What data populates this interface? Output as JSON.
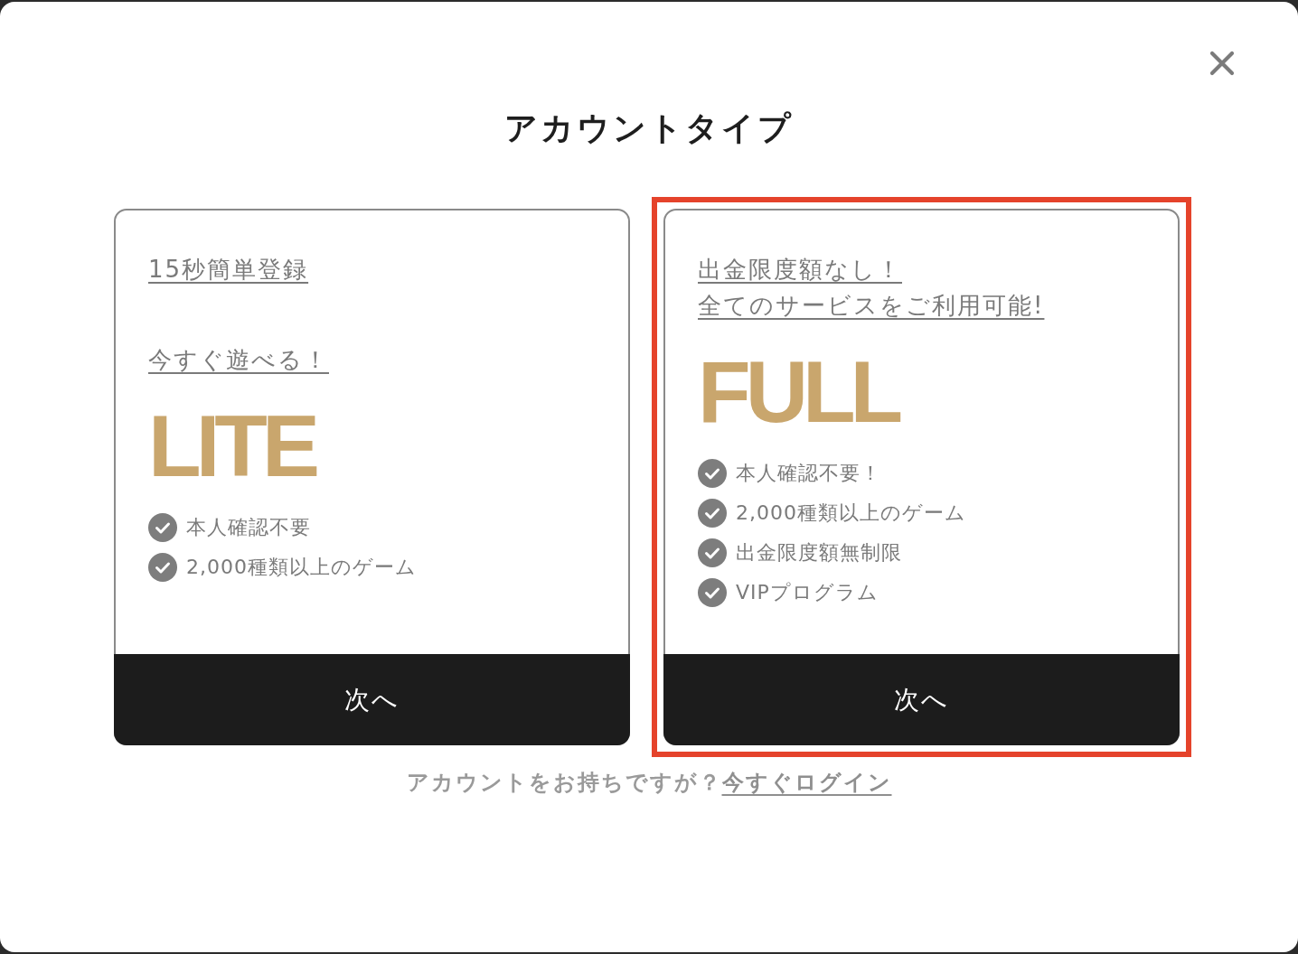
{
  "dialog": {
    "title": "アカウントタイプ"
  },
  "plans": [
    {
      "selected": false,
      "taglines": [
        {
          "lines": [
            "15秒簡単登録"
          ]
        },
        {
          "lines": [
            "今すぐ遊べる！"
          ]
        }
      ],
      "name": "LITE",
      "features": [
        "本人確認不要",
        "2,000種類以上のゲーム"
      ],
      "button": "次へ"
    },
    {
      "selected": true,
      "taglines": [
        {
          "lines": [
            "出金限度額なし！",
            "全てのサービスをご利用可能!"
          ]
        }
      ],
      "name": "FULL",
      "features": [
        "本人確認不要！",
        "2,000種類以上のゲーム",
        "出金限度額無制限",
        "VIPプログラム"
      ],
      "button": "次へ"
    }
  ],
  "footer": {
    "prompt": "アカウントをお持ちですが？",
    "link": "今すぐログイン"
  }
}
